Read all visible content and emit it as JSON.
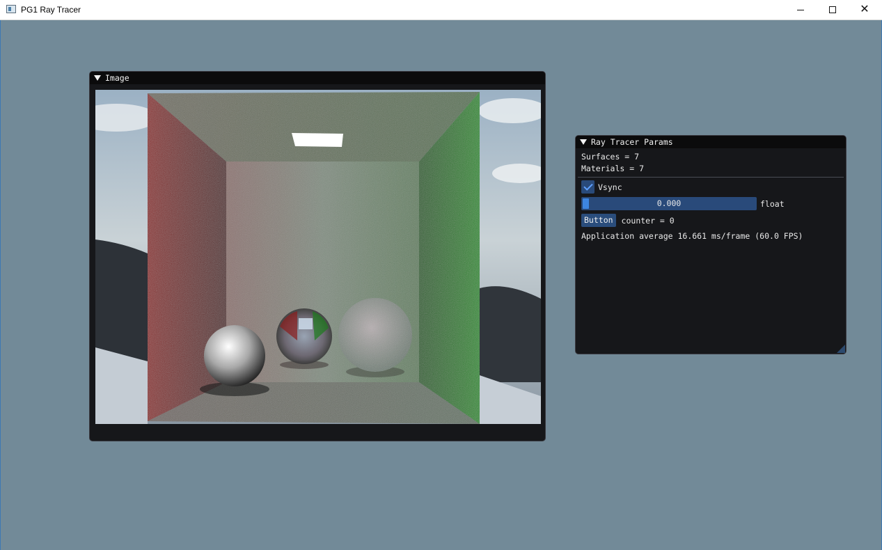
{
  "window": {
    "title": "PG1 Ray Tracer",
    "minimize_glyph": "—",
    "maximize_glyph": "☐",
    "close_glyph": "✕"
  },
  "image_panel": {
    "title": "Image"
  },
  "params_panel": {
    "title": "Ray Tracer Params",
    "surfaces_text": "Surfaces = 7",
    "materials_text": "Materials = 7",
    "vsync_label": "Vsync",
    "vsync_checked": true,
    "slider_value": "0.000",
    "slider_label": "float",
    "button_label": "Button",
    "counter_text": "counter = 0",
    "fps_text": "Application average 16.661 ms/frame (60.0 FPS)"
  },
  "colors": {
    "background": "#728a98",
    "panel_bg": "#16171a",
    "accent": "#294a7a",
    "slider_grab": "#3d85e0"
  }
}
